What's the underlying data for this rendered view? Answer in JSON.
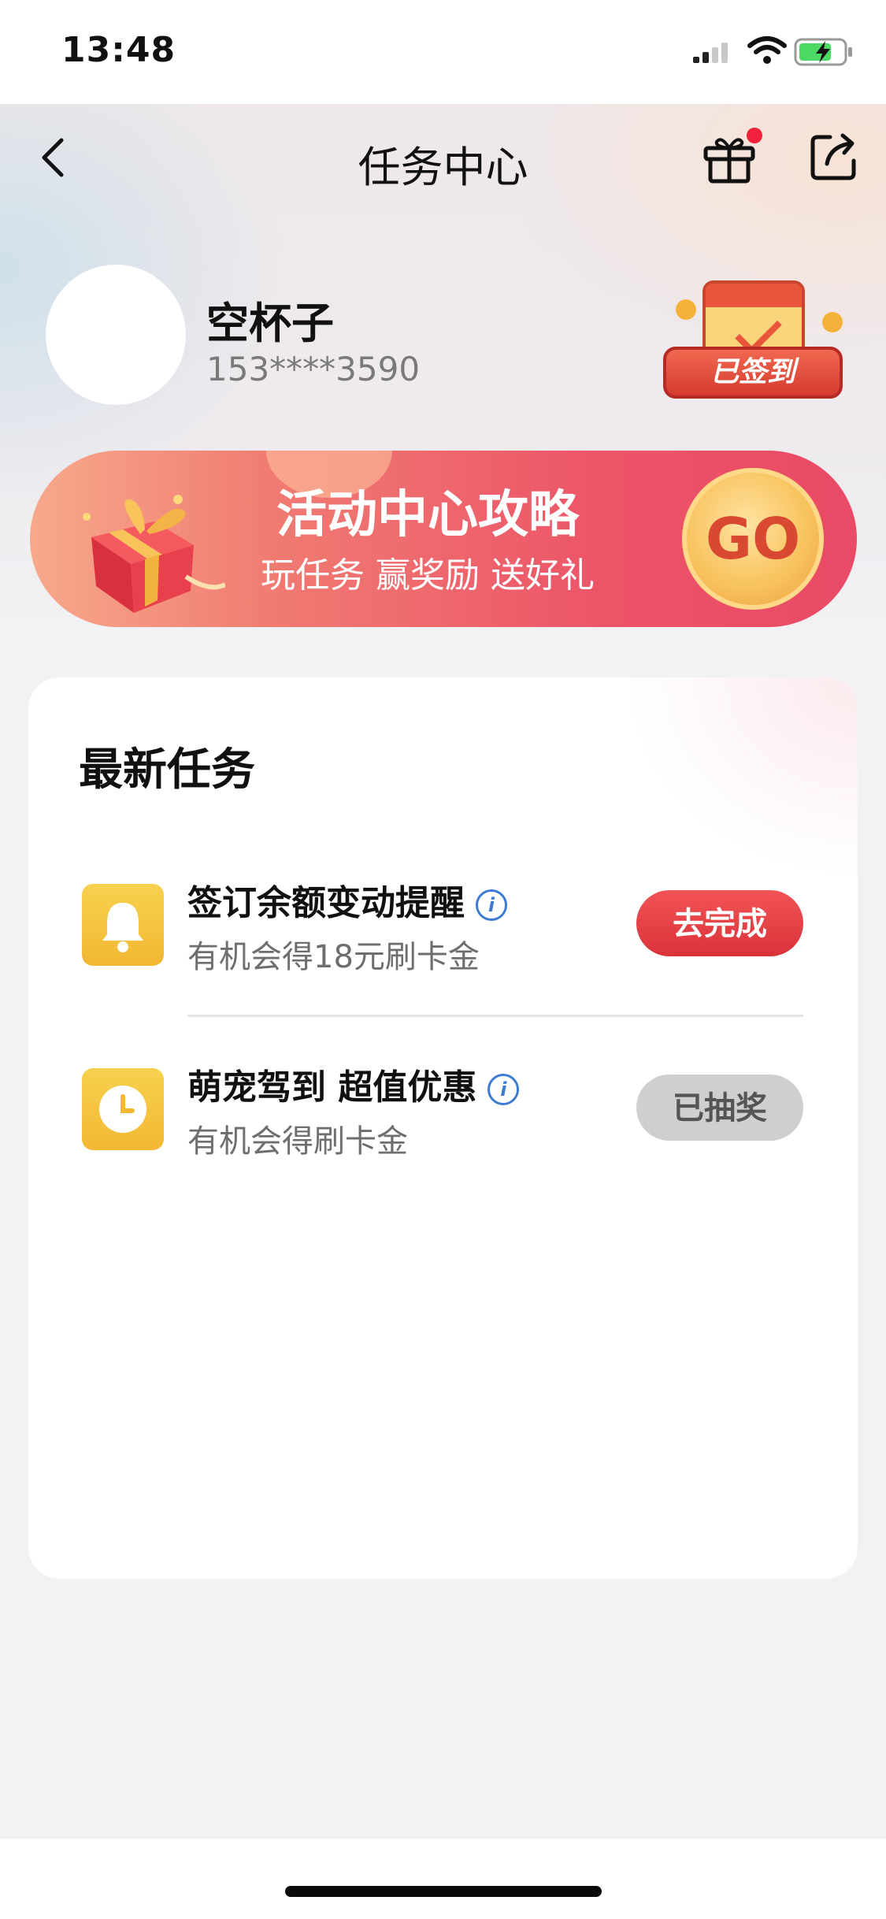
{
  "status_bar": {
    "time": "13:48"
  },
  "nav": {
    "title": "任务中心"
  },
  "user": {
    "name": "空杯子",
    "phone": "153****3590",
    "checkin_badge": "已签到"
  },
  "banner": {
    "title": "活动中心攻略",
    "subtitle": "玩任务 赢奖励 送好礼",
    "go_label": "GO"
  },
  "tasks_section": {
    "title": "最新任务",
    "tasks": [
      {
        "name": "签订余额变动提醒",
        "description": "有机会得18元刷卡金",
        "button_label": "去完成",
        "icon": "bell-icon"
      },
      {
        "name": "萌宠驾到 超值优惠",
        "description": "有机会得刷卡金",
        "button_label": "已抽奖",
        "icon": "clock-icon"
      }
    ],
    "info_glyph": "i"
  },
  "colors": {
    "accent_red": "#e2383d",
    "icon_yellow": "#f4c23d",
    "info_blue": "#3e7cd4"
  }
}
